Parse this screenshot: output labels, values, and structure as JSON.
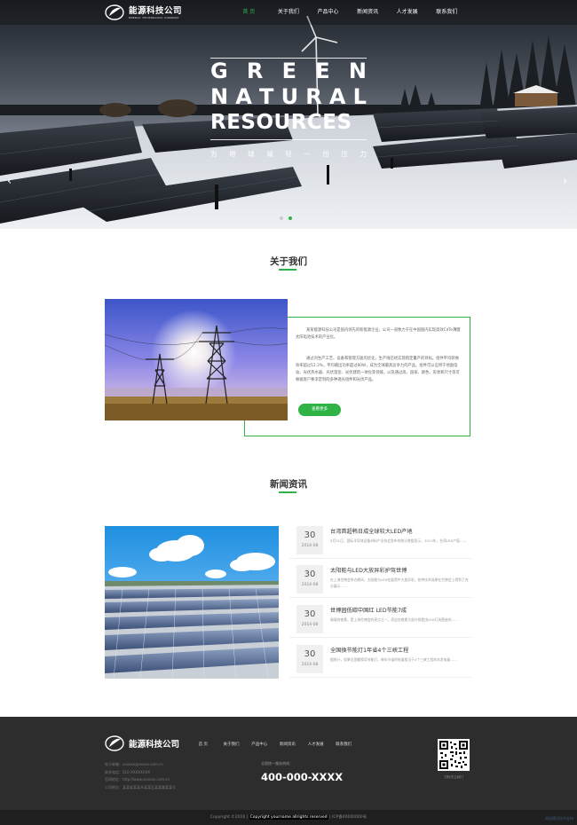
{
  "brand": {
    "name": "能源科技公司",
    "tagline": "ENERGY TECHNOLOGY COMPANY"
  },
  "nav": {
    "items": [
      {
        "label": "首 页",
        "active": true
      },
      {
        "label": "关于我们"
      },
      {
        "label": "产品中心"
      },
      {
        "label": "新闻资讯"
      },
      {
        "label": "人才发展"
      },
      {
        "label": "联系我们"
      }
    ]
  },
  "hero": {
    "word1": [
      "G",
      "R",
      "E",
      "E",
      "N"
    ],
    "word2": [
      "N",
      "A",
      "T",
      "U",
      "R",
      "A",
      "L"
    ],
    "word3": "RESOURCES",
    "subtitle": [
      "为",
      "地",
      "球",
      "减",
      "轻",
      "一",
      "份",
      "压",
      "力"
    ],
    "prev_icon": "chevron-left-icon",
    "next_icon": "chevron-right-icon",
    "slides_total": 2,
    "active_slide": 2
  },
  "about": {
    "title": "关于我们",
    "paragraphs": [
      "某某能源科技公司是国内领先的新能源企业，公司一直致力于在中国国内实现高效CdTe薄膜太阳电池技术的产业化。",
      "通过对生产工艺、设备和管理方面的优化，生产线已经实现稳定量产的目标。组件平均转换效率超过12.3%，平均输出功率超过80W，成为全球最具竞争力的产品。组件可以应用于地面电站、光伏热水器、光伏温室、光伏建筑一体化等领域，以及通过高、国家、颜色、形状和尺寸等可根据客户要求定制的多种透光组件和光伏产品。"
    ],
    "more_label": "查看更多",
    "accent": "#2fb346"
  },
  "news": {
    "title": "新闻资讯",
    "items": [
      {
        "day": "30",
        "ym": "2014-08",
        "title": "台湾首超韩日成全球较大LED产地",
        "excerpt": "5月31日，国际半导体设备材料产业协会发布的统计数据显示，2013年，台湾LED产值……"
      },
      {
        "day": "30",
        "ym": "2014-08",
        "title": "太阳能与LED大放异彩护驾世博",
        "excerpt": "在上海世博会举办期间，太阳能与LED在展馆中大放异彩，各种技术成果在世博会上得到了充分展示……"
      },
      {
        "day": "30",
        "ym": "2014-08",
        "title": "世博园低碳中国红 LED节能7成",
        "excerpt": "璀璨的夜景，是上海世博会的亮点之一，而这些夜景大部分都是由LED灯具营造的……"
      },
      {
        "day": "30",
        "ym": "2014-08",
        "title": "全国換节能灯1年省4个三峡工程",
        "excerpt": "据统计，如果全国都换用节能灯，每年节省的电量相当于4个三峡工程的年发电量……"
      }
    ]
  },
  "footer": {
    "brand": "能源科技公司",
    "nav": [
      "首 页",
      "关于我们",
      "产品中心",
      "新闻资讯",
      "人才发展",
      "联系我们"
    ],
    "contact": [
      "电子邮箱：xxxxxx@xxxxx.com.cn",
      "联系电话：010-XXXXXXXX",
      "官网地址：http://www.xxxxxx.com.cn",
      "公司地址：某某省某某市某某区某某路某某号"
    ],
    "hotline_label": "全国统一服务热线：",
    "phone": "400-000-XXXX",
    "qr_label": "扫码关注我们",
    "copyright": "Copyright ©2016",
    "copyright_highlight": "Copyright yourname allrights reserved",
    "icp": "ICP备00000000号",
    "corner": "网站建设技术支持"
  }
}
